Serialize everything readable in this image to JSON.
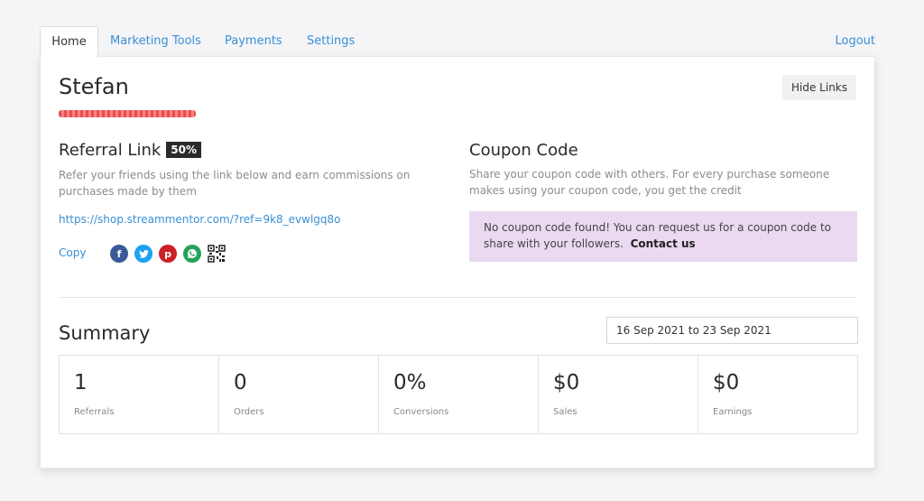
{
  "tabs": {
    "home": "Home",
    "marketing": "Marketing Tools",
    "payments": "Payments",
    "settings": "Settings",
    "logout": "Logout"
  },
  "user": {
    "name": "Stefan"
  },
  "actions": {
    "hide_links": "Hide Links"
  },
  "referral": {
    "title": "Referral Link",
    "badge": "50%",
    "desc": "Refer your friends using the link below and earn commissions on purchases made by them",
    "url": "https://shop.streammentor.com/?ref=9k8_evwlgq8o",
    "copy": "Copy",
    "share_icons": [
      "facebook-icon",
      "twitter-icon",
      "pinterest-icon",
      "whatsapp-icon",
      "qr-code-icon"
    ]
  },
  "coupon": {
    "title": "Coupon Code",
    "desc": "Share your coupon code with others. For every purchase someone makes using your coupon code, you get the credit",
    "notice": "No coupon code found! You can request us for a coupon code to share with your followers.",
    "contact": "Contact us"
  },
  "summary": {
    "title": "Summary",
    "date_range": "16 Sep 2021 to 23 Sep 2021",
    "stats": [
      {
        "value": "1",
        "label": "Referrals"
      },
      {
        "value": "0",
        "label": "Orders"
      },
      {
        "value": "0%",
        "label": "Conversions"
      },
      {
        "value": "$0",
        "label": "Sales"
      },
      {
        "value": "$0",
        "label": "Earnings"
      }
    ]
  },
  "colors": {
    "accent": "#3a8fd6",
    "coupon_bg": "#ead9f0",
    "badge_bg": "#2b2b2b"
  }
}
